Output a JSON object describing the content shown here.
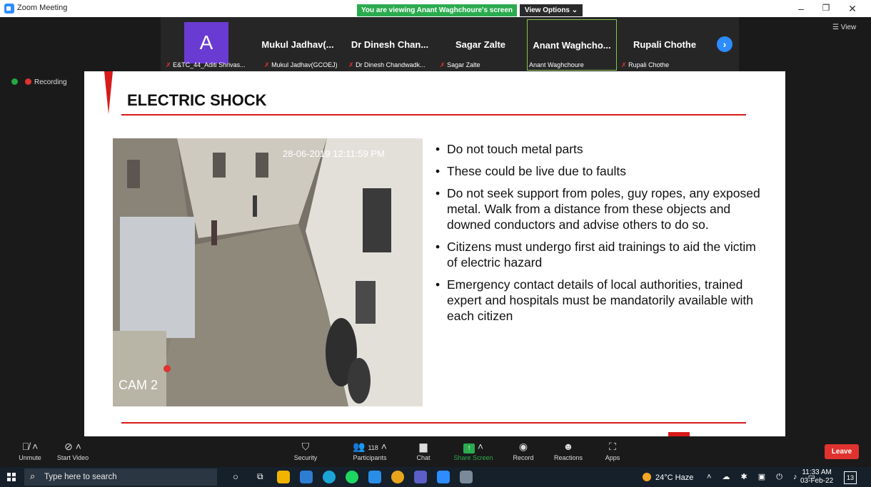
{
  "window": {
    "title": "Zoom Meeting"
  },
  "banner": {
    "viewing": "You are viewing Anant Waghchoure's screen",
    "view_options": "View Options ⌄"
  },
  "gallery": {
    "tiles": [
      {
        "name": "",
        "caption": "E&TC_44_Aditi Shrivas...",
        "muted": true,
        "avatar": "A"
      },
      {
        "name": "Mukul Jadhav(...",
        "caption": "Mukul Jadhav(GCOEJ)",
        "muted": true
      },
      {
        "name": "Dr Dinesh Chan...",
        "caption": "Dr Dinesh Chandwadk...",
        "muted": true
      },
      {
        "name": "Sagar Zalte",
        "caption": "Sagar Zalte",
        "muted": true
      },
      {
        "name": "Anant Waghcho...",
        "caption": "Anant Waghchoure",
        "muted": false
      },
      {
        "name": "Rupali Chothe",
        "caption": "Rupali Chothe",
        "muted": true
      }
    ],
    "view_label": "View"
  },
  "recording": {
    "label": "Recording"
  },
  "slide": {
    "title": "ELECTRIC SHOCK",
    "photo": {
      "timestamp": "28-06-2019 12:11:59 PM",
      "camera": "CAM 2"
    },
    "bullets": [
      "Do not touch metal parts",
      "These could be live due to faults",
      "Do not seek support from poles, guy ropes, any exposed metal. Walk from a distance from these objects and downed conductors and advise others to do so.",
      "Citizens must undergo first aid trainings to aid the victim of electric hazard",
      "Emergency contact details of local authorities, trained expert and hospitals must be mandatorily available with each citizen"
    ]
  },
  "toolbar": {
    "unmute": "Unmute",
    "start_video": "Start Video",
    "security": "Security",
    "participants": "Participants",
    "participants_count": "118",
    "chat": "Chat",
    "share_screen": "Share Screen",
    "record": "Record",
    "reactions": "Reactions",
    "apps": "Apps",
    "leave": "Leave"
  },
  "taskbar": {
    "search_placeholder": "Type here to search",
    "weather": "24°C Haze",
    "time": "11:33 AM",
    "date": "03-Feb-22",
    "notifications": "13"
  },
  "colors": {
    "accent": "#2d8cff",
    "share_green": "#2bab4f",
    "leave_red": "#e0322e",
    "slide_red": "#d91a1a"
  }
}
